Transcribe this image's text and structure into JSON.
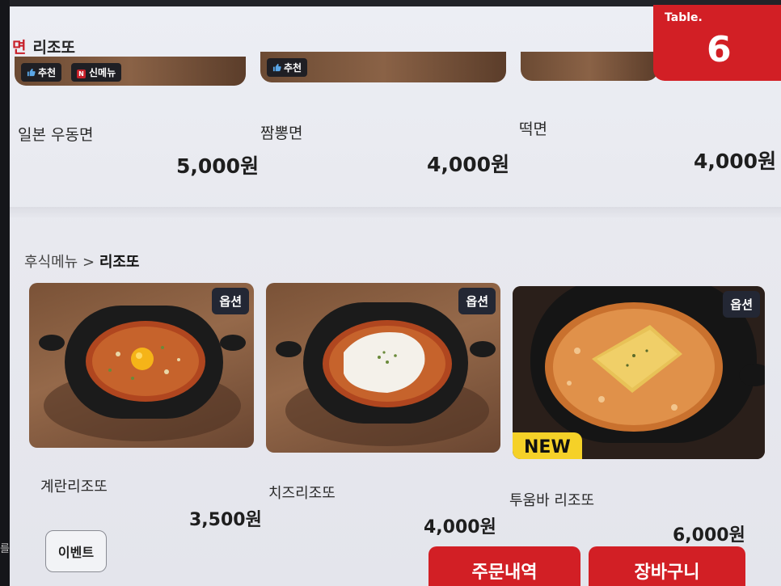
{
  "header": {
    "category_prefix": "면",
    "category_title": "리조또",
    "table_label": "Table.",
    "table_number": "6"
  },
  "top_row": {
    "badges": {
      "recommend": "추천",
      "new_menu": "신메뉴",
      "new_menu_icon_letter": "N"
    },
    "items": [
      {
        "name": "일본 우동면",
        "price": "5,000원"
      },
      {
        "name": "짬뽕면",
        "price": "4,000원"
      },
      {
        "name": "떡면",
        "price": "4,000원"
      }
    ]
  },
  "breadcrumb": {
    "parent": "후식메뉴",
    "separator": ">",
    "current": "리조또"
  },
  "menu": {
    "option_label": "옵션",
    "new_label": "NEW",
    "items": [
      {
        "name": "계란리조또",
        "price": "3,500원",
        "topping": "egg-yolk"
      },
      {
        "name": "치즈리조또",
        "price": "4,000원",
        "topping": "melted-cheese"
      },
      {
        "name": "투움바 리조또",
        "price": "6,000원",
        "topping": "cheese-slice"
      }
    ]
  },
  "footer": {
    "event_label": "이벤트",
    "order_history_label": "주문내역",
    "cart_label": "장바구니",
    "side_text": "를"
  },
  "colors": {
    "accent": "#d21f25",
    "option_bg": "#232734",
    "new_badge": "#f5d128"
  }
}
